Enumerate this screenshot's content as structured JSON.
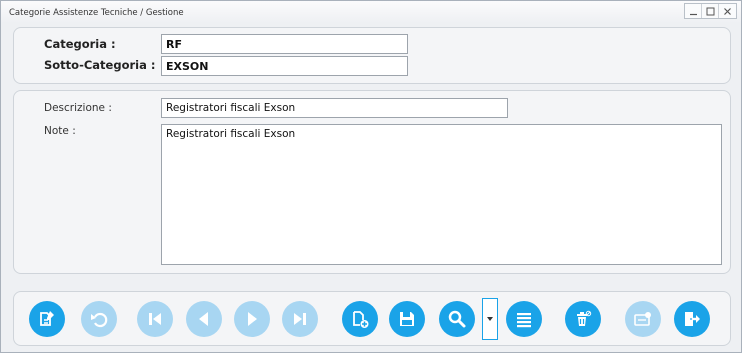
{
  "window": {
    "title": "Categorie Assistenze Tecniche / Gestione",
    "controls": [
      "minimize-icon",
      "maximize-icon",
      "close-icon"
    ]
  },
  "header": {
    "categoria_label": "Categoria :",
    "categoria_value": "RF",
    "sottocategoria_label": "Sotto-Categoria :",
    "sottocategoria_value": "EXSON"
  },
  "details": {
    "descrizione_label": "Descrizione :",
    "descrizione_value": "Registratori fiscali Exson",
    "note_label": "Note :",
    "note_value": "Registratori fiscali Exson"
  },
  "toolbar": {
    "accent_color": "#1aa3e8",
    "disabled_color": "#a8d6f2",
    "buttons": [
      {
        "icon": "edit-document-icon",
        "enabled": true
      },
      {
        "icon": "undo-icon",
        "enabled": false
      },
      {
        "icon": "first-record-icon",
        "enabled": false
      },
      {
        "icon": "previous-record-icon",
        "enabled": false
      },
      {
        "icon": "next-record-icon",
        "enabled": false
      },
      {
        "icon": "last-record-icon",
        "enabled": false
      },
      {
        "icon": "new-document-icon",
        "enabled": true
      },
      {
        "icon": "save-icon",
        "enabled": true
      },
      {
        "icon": "search-icon",
        "enabled": true
      },
      {
        "icon": "dropdown-arrow-icon",
        "enabled": true
      },
      {
        "icon": "list-icon",
        "enabled": true
      },
      {
        "icon": "delete-icon",
        "enabled": true
      },
      {
        "icon": "print-icon",
        "enabled": false
      },
      {
        "icon": "exit-icon",
        "enabled": true
      }
    ]
  }
}
